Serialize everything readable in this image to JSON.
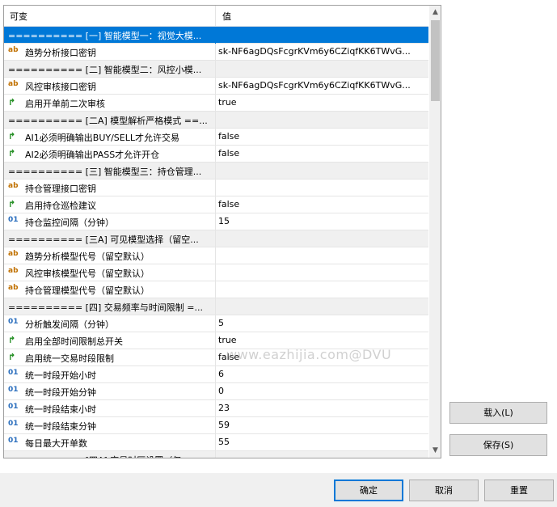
{
  "header": {
    "col_name": "可变",
    "col_value": "值"
  },
  "rows": [
    {
      "icon": "",
      "name": "========== [一] 智能模型一：视觉大模...",
      "value": "",
      "group": true,
      "selected": true
    },
    {
      "icon": "ab",
      "name": "趋势分析接口密钥",
      "value": "sk-NF6agDQsFcgrKVm6y6CZiqfKK6TWvG..."
    },
    {
      "icon": "",
      "name": "========== [二] 智能模型二：风控小模...",
      "value": "",
      "group": true
    },
    {
      "icon": "ab",
      "name": "风控审核接口密钥",
      "value": "sk-NF6agDQsFcgrKVm6y6CZiqfKK6TWvG..."
    },
    {
      "icon": "bool",
      "name": "启用开单前二次审核",
      "value": "true"
    },
    {
      "icon": "",
      "name": "========== [二A] 模型解析严格模式 ==...",
      "value": "",
      "group": true
    },
    {
      "icon": "bool",
      "name": "AI1必须明确输出BUY/SELL才允许交易",
      "value": "false"
    },
    {
      "icon": "bool",
      "name": "AI2必须明确输出PASS才允许开仓",
      "value": "false"
    },
    {
      "icon": "",
      "name": "========== [三] 智能模型三：持仓管理...",
      "value": "",
      "group": true
    },
    {
      "icon": "ab",
      "name": "持仓管理接口密钥",
      "value": ""
    },
    {
      "icon": "bool",
      "name": "启用持仓巡检建议",
      "value": "false"
    },
    {
      "icon": "01",
      "name": "持仓监控间隔（分钟）",
      "value": "15"
    },
    {
      "icon": "",
      "name": "========== [三A] 可见模型选择（留空...",
      "value": "",
      "group": true
    },
    {
      "icon": "ab",
      "name": "趋势分析模型代号（留空默认）",
      "value": ""
    },
    {
      "icon": "ab",
      "name": "风控审核模型代号（留空默认）",
      "value": ""
    },
    {
      "icon": "ab",
      "name": "持仓管理模型代号（留空默认）",
      "value": ""
    },
    {
      "icon": "",
      "name": "========== [四] 交易频率与时间限制 =...",
      "value": "",
      "group": true
    },
    {
      "icon": "01",
      "name": "分析触发间隔（分钟）",
      "value": "5"
    },
    {
      "icon": "bool",
      "name": "启用全部时间限制总开关",
      "value": "true"
    },
    {
      "icon": "bool",
      "name": "启用统一交易时段限制",
      "value": "false"
    },
    {
      "icon": "01",
      "name": "统一时段开始小时",
      "value": "6"
    },
    {
      "icon": "01",
      "name": "统一时段开始分钟",
      "value": "0"
    },
    {
      "icon": "01",
      "name": "统一时段结束小时",
      "value": "23"
    },
    {
      "icon": "01",
      "name": "统一时段结束分钟",
      "value": "59"
    },
    {
      "icon": "01",
      "name": "每日最大开单数",
      "value": "55"
    },
    {
      "icon": "",
      "name": "========== [四A] 交易时区设置（仅...",
      "value": "",
      "group": true
    }
  ],
  "watermark": "www.eazhijia.com@DVU",
  "buttons": {
    "load": "载入(L)",
    "save": "保存(S)",
    "ok": "确定",
    "cancel": "取消",
    "reset": "重置"
  },
  "icons": {
    "string": "string-icon",
    "bool": "bool-icon",
    "number": "number-icon"
  },
  "colors": {
    "selection": "#0078d7",
    "group_bg": "#f0f0f0"
  }
}
